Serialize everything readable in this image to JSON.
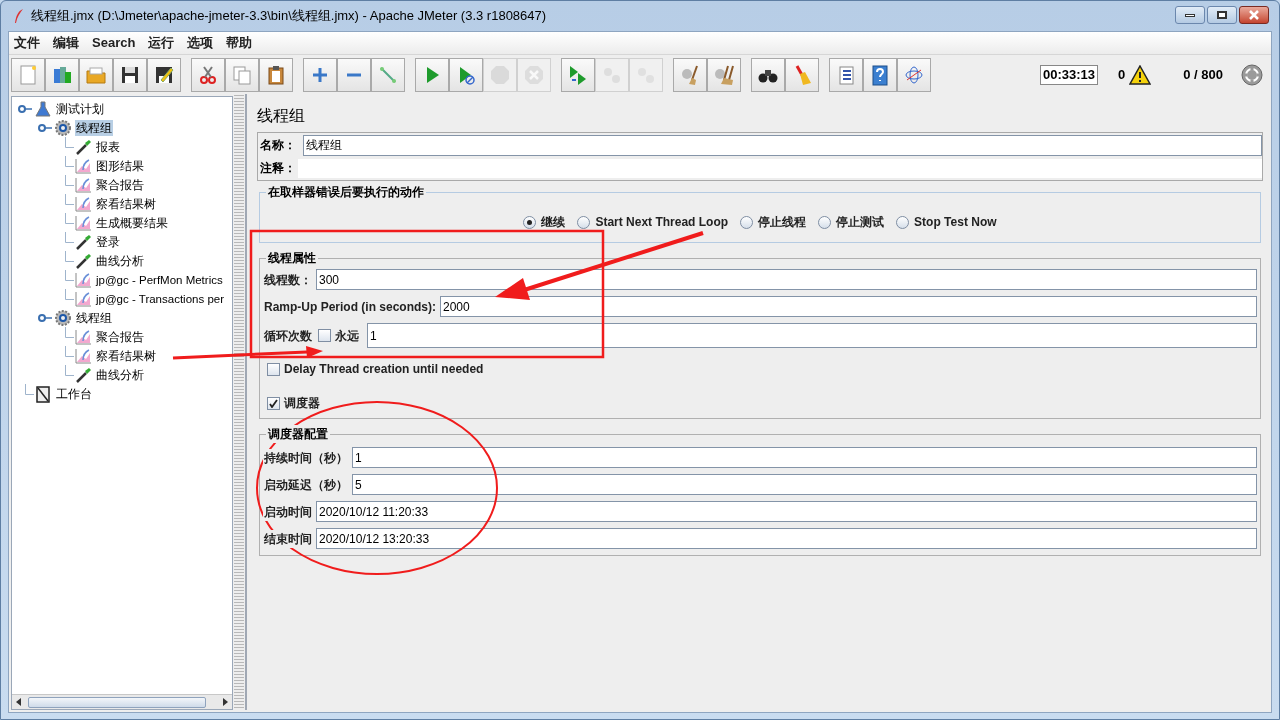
{
  "window": {
    "title": "线程组.jmx (D:\\Jmeter\\apache-jmeter-3.3\\bin\\线程组.jmx) - Apache JMeter (3.3 r1808647)"
  },
  "menu": [
    "文件",
    "编辑",
    "Search",
    "运行",
    "选项",
    "帮助"
  ],
  "toolbar": [
    [
      {
        "kind": "new",
        "disabled": false
      },
      {
        "kind": "templates",
        "disabled": false
      },
      {
        "kind": "open",
        "disabled": false
      },
      {
        "kind": "save",
        "disabled": false
      },
      {
        "kind": "save-as",
        "disabled": false
      }
    ],
    [
      {
        "kind": "cut",
        "disabled": false
      },
      {
        "kind": "copy",
        "disabled": false
      },
      {
        "kind": "paste",
        "disabled": false
      }
    ],
    [
      {
        "kind": "expand",
        "disabled": false
      },
      {
        "kind": "collapse",
        "disabled": false
      },
      {
        "kind": "toggle",
        "disabled": false
      }
    ],
    [
      {
        "kind": "start",
        "disabled": false
      },
      {
        "kind": "start-no-pause",
        "disabled": false
      },
      {
        "kind": "stop",
        "disabled": true
      },
      {
        "kind": "shutdown",
        "disabled": true
      }
    ],
    [
      {
        "kind": "remote-start",
        "disabled": false
      },
      {
        "kind": "remote-stop",
        "disabled": true
      },
      {
        "kind": "remote-shutdown",
        "disabled": true
      }
    ],
    [
      {
        "kind": "clear",
        "disabled": false
      },
      {
        "kind": "clear-all",
        "disabled": false
      }
    ],
    [
      {
        "kind": "search",
        "disabled": false
      },
      {
        "kind": "reset",
        "disabled": false
      }
    ],
    [
      {
        "kind": "list",
        "disabled": false
      },
      {
        "kind": "help",
        "disabled": false
      },
      {
        "kind": "log",
        "disabled": false
      }
    ]
  ],
  "status": {
    "timer": "00:33:13",
    "warnings": "0",
    "threads": "0 / 800"
  },
  "tree": [
    {
      "label": "测试计划",
      "kind": "plan",
      "selected": false,
      "children": [
        {
          "label": "线程组",
          "kind": "thread-group",
          "selected": true,
          "children": [
            {
              "label": "报表",
              "kind": "sampler",
              "selected": false
            },
            {
              "label": "图形结果",
              "kind": "listener",
              "selected": false
            },
            {
              "label": "聚合报告",
              "kind": "listener",
              "selected": false
            },
            {
              "label": "察看结果树",
              "kind": "listener",
              "selected": false
            },
            {
              "label": "生成概要结果",
              "kind": "listener",
              "selected": false
            },
            {
              "label": "登录",
              "kind": "sampler",
              "selected": false
            },
            {
              "label": "曲线分析",
              "kind": "sampler",
              "selected": false
            },
            {
              "label": "jp@gc - PerfMon Metrics",
              "kind": "listener",
              "selected": false
            },
            {
              "label": "jp@gc - Transactions per",
              "kind": "listener",
              "selected": false
            }
          ]
        },
        {
          "label": "线程组",
          "kind": "thread-group",
          "selected": false,
          "children": [
            {
              "label": "聚合报告",
              "kind": "listener",
              "selected": false
            },
            {
              "label": "察看结果树",
              "kind": "listener",
              "selected": false
            },
            {
              "label": "曲线分析",
              "kind": "sampler",
              "selected": false
            }
          ]
        }
      ]
    },
    {
      "label": "工作台",
      "kind": "workbench",
      "selected": false
    }
  ],
  "panel": {
    "title": "线程组",
    "name": {
      "label": "名称：",
      "value": "线程组"
    },
    "comment": {
      "label": "注释："
    },
    "on_error": {
      "legend": "在取样器错误后要执行的动作",
      "options": [
        {
          "label": "继续",
          "selected": true
        },
        {
          "label": "Start Next Thread Loop",
          "selected": false
        },
        {
          "label": "停止线程",
          "selected": false
        },
        {
          "label": "停止测试",
          "selected": false
        },
        {
          "label": "Stop Test Now",
          "selected": false
        }
      ]
    },
    "thread_properties": {
      "legend": "线程属性",
      "threads": {
        "label": "线程数：",
        "value": "300"
      },
      "ramp_up": {
        "label": "Ramp-Up Period (in seconds):",
        "value": "2000"
      },
      "loop": {
        "label": "循环次数",
        "forever_label": "永远",
        "forever_checked": false,
        "value": "1"
      },
      "delay": {
        "label": "Delay Thread creation until needed",
        "checked": false
      },
      "scheduler": {
        "label": "调度器",
        "checked": true
      }
    },
    "scheduler_config": {
      "legend": "调度器配置",
      "fields": [
        {
          "label": "持续时间（秒）",
          "value": "1"
        },
        {
          "label": "启动延迟（秒）",
          "value": "5"
        },
        {
          "label": "启动时间",
          "value": "2020/10/12 11:20:33"
        },
        {
          "label": "结束时间",
          "value": "2020/10/12 13:20:33"
        }
      ]
    }
  }
}
